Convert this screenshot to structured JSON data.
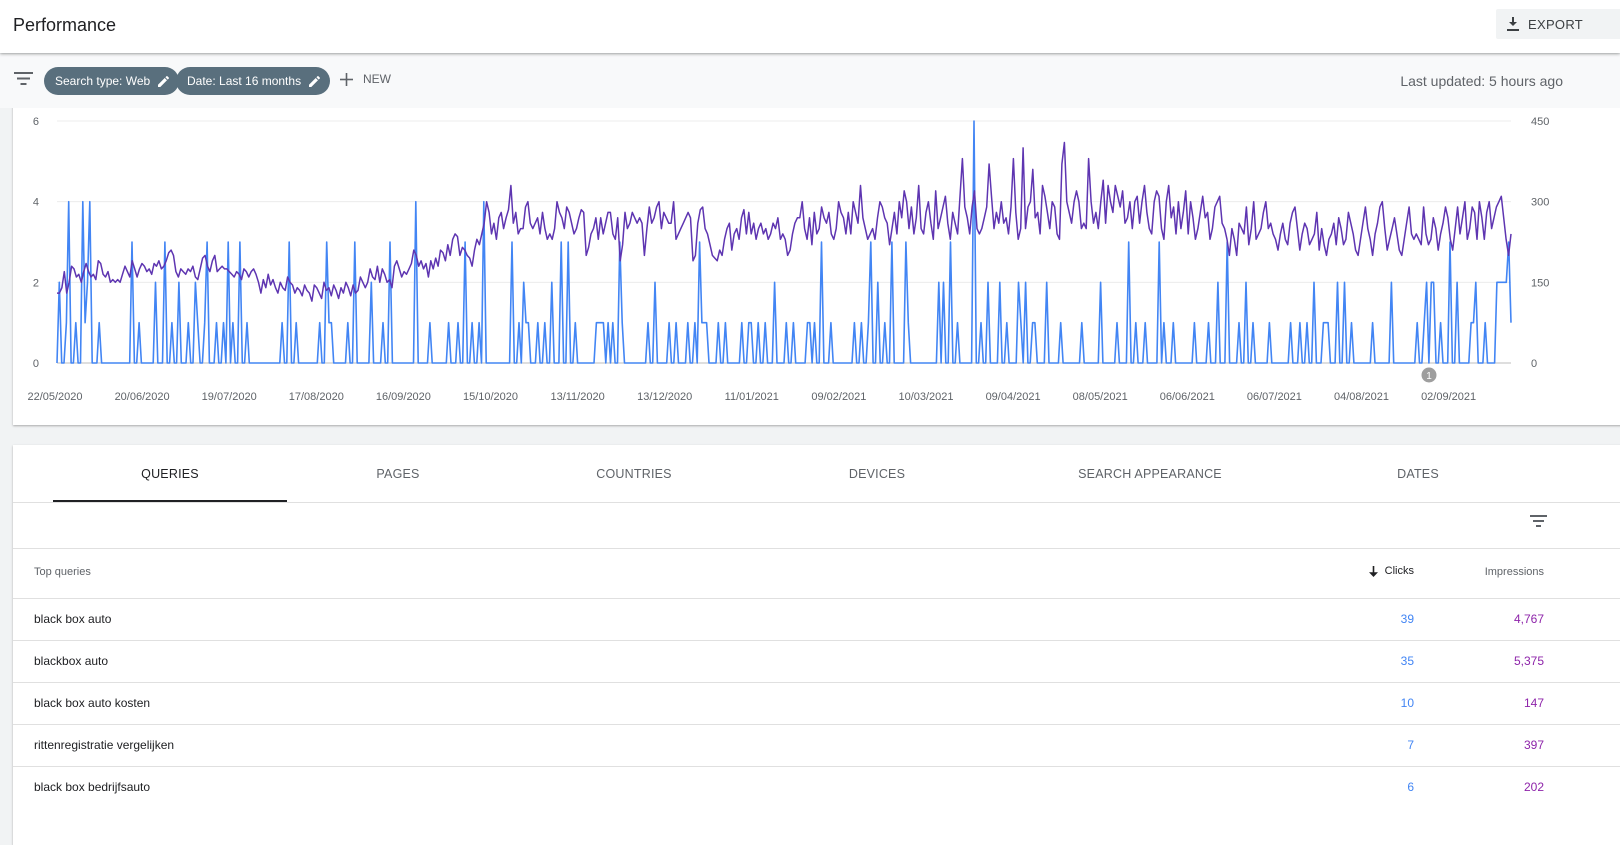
{
  "header": {
    "title": "Performance",
    "export_label": "EXPORT"
  },
  "filters": {
    "chips": [
      "Search type: Web",
      "Date: Last 16 months"
    ],
    "new_label": "NEW",
    "last_updated": "Last updated: 5 hours ago"
  },
  "chart_data": {
    "type": "line",
    "x_tick_labels": [
      "22/05/2020",
      "20/06/2020",
      "19/07/2020",
      "17/08/2020",
      "16/09/2020",
      "15/10/2020",
      "13/11/2020",
      "13/12/2020",
      "11/01/2021",
      "09/02/2021",
      "10/03/2021",
      "09/04/2021",
      "08/05/2021",
      "06/06/2021",
      "06/07/2021",
      "04/08/2021",
      "02/09/2021"
    ],
    "y_left_ticks": [
      "0",
      "2",
      "4",
      "6"
    ],
    "y_right_ticks": [
      "0",
      "150",
      "300",
      "450"
    ],
    "ylim_left": [
      0,
      6
    ],
    "ylim_right": [
      0,
      450
    ],
    "annotation": "1",
    "series": [
      {
        "color": "#4285f4",
        "axis": "left",
        "values": [
          0,
          2,
          0,
          0,
          1,
          4,
          0,
          0,
          1,
          0,
          0,
          4,
          1,
          2,
          4,
          0,
          0,
          0,
          1,
          0,
          0,
          0,
          0,
          0,
          0,
          0,
          0,
          0,
          0,
          0,
          0,
          0,
          3,
          0,
          0,
          1,
          0,
          0,
          0,
          0,
          0,
          0,
          2,
          0,
          0,
          0,
          3,
          0,
          0,
          1,
          0,
          0,
          2,
          0,
          0,
          0,
          1,
          0,
          0,
          2,
          1,
          0,
          0,
          1,
          3,
          0,
          0,
          0,
          1,
          0,
          0,
          1,
          0,
          3,
          0,
          1,
          0,
          0,
          3,
          0,
          0,
          1,
          0,
          0,
          0,
          0,
          0,
          0,
          0,
          0,
          0,
          0,
          0,
          0,
          0,
          0,
          1,
          0,
          0,
          3,
          0,
          0,
          1,
          0,
          0,
          0,
          0,
          0,
          0,
          0,
          0,
          0,
          1,
          0,
          0,
          3,
          1,
          1,
          0,
          0,
          0,
          0,
          0,
          0,
          1,
          0,
          0,
          3,
          0,
          0,
          0,
          0,
          0,
          0,
          2,
          0,
          0,
          0,
          0,
          1,
          0,
          0,
          3,
          0,
          0,
          0,
          0,
          0,
          0,
          0,
          0,
          0,
          0,
          4,
          0,
          0,
          0,
          0,
          0,
          1,
          0,
          0,
          0,
          0,
          0,
          0,
          0,
          1,
          0,
          0,
          0,
          1,
          0,
          0,
          3,
          0,
          0,
          1,
          0,
          0,
          1,
          0,
          4,
          0,
          0,
          0,
          0,
          0,
          0,
          0,
          0,
          0,
          0,
          0,
          3,
          0,
          0,
          1,
          0,
          2,
          1,
          1,
          0,
          0,
          0,
          1,
          0,
          0,
          1,
          0,
          0,
          2,
          0,
          0,
          0,
          3,
          0,
          0,
          3,
          0,
          0,
          1,
          0,
          0,
          0,
          0,
          0,
          0,
          0,
          0,
          1,
          1,
          1,
          1,
          0,
          1,
          0,
          1,
          0,
          0,
          3,
          1,
          0,
          0,
          0,
          0,
          0,
          0,
          0,
          0,
          0,
          0,
          1,
          0,
          0,
          2,
          0,
          0,
          0,
          0,
          0,
          1,
          0,
          0,
          1,
          0,
          0,
          0,
          0,
          1,
          0,
          0,
          1,
          0,
          3,
          1,
          1,
          1,
          0,
          0,
          0,
          0,
          1,
          0,
          0,
          1,
          0,
          0,
          0,
          0,
          0,
          0,
          1,
          0,
          0,
          1,
          1,
          0,
          0,
          1,
          0,
          0,
          1,
          0,
          0,
          0,
          2,
          0,
          0,
          0,
          0,
          1,
          0,
          0,
          1,
          0,
          0,
          0,
          0,
          0,
          1,
          1,
          0,
          1,
          0,
          0,
          3,
          0,
          0,
          0,
          1,
          0,
          0,
          0,
          0,
          0,
          0,
          0,
          0,
          0,
          1,
          0,
          0,
          1,
          0,
          0,
          1,
          3,
          0,
          0,
          2,
          0,
          0,
          1,
          0,
          0,
          3,
          0,
          0,
          0,
          0,
          0,
          3,
          1,
          0,
          0,
          0,
          0,
          0,
          0,
          0,
          0,
          0,
          0,
          0,
          0,
          2,
          0,
          2,
          0,
          0,
          3,
          0,
          0,
          1,
          0,
          0,
          0,
          0,
          0,
          0,
          6,
          0,
          0,
          1,
          0,
          0,
          2,
          0,
          0,
          0,
          0,
          2,
          0,
          0,
          1,
          0,
          0,
          0,
          0,
          2,
          1,
          0,
          2,
          0,
          0,
          1,
          1,
          0,
          0,
          0,
          0,
          2,
          0,
          0,
          0,
          0,
          0,
          1,
          0,
          0,
          0,
          0,
          0,
          0,
          0,
          0,
          1,
          0,
          0,
          0,
          0,
          0,
          0,
          0,
          2,
          0,
          0,
          0,
          0,
          0,
          0,
          1,
          0,
          0,
          0,
          0,
          3,
          0,
          0,
          1,
          0,
          0,
          0,
          1,
          0,
          0,
          0,
          0,
          0,
          3,
          0,
          1,
          0,
          0,
          0,
          1,
          0,
          0,
          0,
          0,
          0,
          0,
          0,
          0,
          1,
          0,
          0,
          0,
          0,
          0,
          1,
          0,
          0,
          0,
          2,
          0,
          0,
          0,
          3,
          0,
          0,
          0,
          0,
          1,
          0,
          0,
          2,
          0,
          0,
          1,
          0,
          0,
          0,
          0,
          0,
          0,
          1,
          0,
          0,
          0,
          0,
          0,
          0,
          0,
          0,
          1,
          0,
          0,
          0,
          1,
          0,
          0,
          1,
          0,
          0,
          2,
          0,
          0,
          0,
          1,
          1,
          1,
          0,
          0,
          0,
          2,
          0,
          0,
          2,
          0,
          0,
          1,
          0,
          0,
          0,
          0,
          0,
          0,
          0,
          0,
          1,
          0,
          0,
          0,
          0,
          0,
          0,
          0,
          2,
          0,
          0,
          0,
          0,
          0,
          0,
          0,
          0,
          0,
          0,
          1,
          0,
          0,
          1,
          2,
          0,
          2,
          2,
          0,
          0,
          1,
          0,
          0,
          0,
          3,
          0,
          0,
          2,
          0,
          0,
          0,
          0,
          0,
          1,
          1,
          2,
          0,
          0,
          0,
          1,
          0,
          0,
          0,
          0,
          2,
          2,
          2,
          2,
          2,
          3,
          1
        ]
      },
      {
        "color": "#5e35b1",
        "axis": "right",
        "values": [
          130,
          130,
          140,
          170,
          130,
          150,
          180,
          175,
          160,
          165,
          150,
          170,
          185,
          170,
          160,
          165,
          155,
          190,
          185,
          165,
          160,
          170,
          150,
          155,
          150,
          155,
          150,
          165,
          180,
          170,
          160,
          190,
          175,
          160,
          175,
          185,
          180,
          170,
          175,
          165,
          185,
          180,
          190,
          175,
          180,
          190,
          205,
          210,
          200,
          170,
          160,
          175,
          170,
          165,
          175,
          170,
          180,
          160,
          155,
          175,
          195,
          200,
          180,
          170,
          190,
          200,
          170,
          175,
          180,
          175,
          175,
          170,
          165,
          160,
          170,
          165,
          155,
          175,
          170,
          160,
          170,
          175,
          165,
          150,
          130,
          155,
          140,
          165,
          145,
          155,
          140,
          130,
          150,
          140,
          135,
          160,
          150,
          145,
          130,
          140,
          135,
          125,
          145,
          135,
          130,
          115,
          145,
          140,
          130,
          120,
          150,
          135,
          140,
          125,
          145,
          135,
          120,
          140,
          130,
          150,
          140,
          125,
          145,
          130,
          135,
          160,
          150,
          140,
          150,
          175,
          160,
          155,
          180,
          150,
          175,
          165,
          150,
          155,
          140,
          180,
          190,
          175,
          160,
          170,
          165,
          175,
          185,
          210,
          200,
          180,
          190,
          175,
          185,
          160,
          190,
          175,
          195,
          180,
          210,
          205,
          190,
          220,
          200,
          230,
          240,
          235,
          200,
          215,
          210,
          200,
          195,
          180,
          210,
          230,
          220,
          240,
          260,
          300,
          280,
          240,
          260,
          230,
          270,
          280,
          250,
          270,
          285,
          330,
          260,
          280,
          240,
          250,
          250,
          290,
          300,
          260,
          250,
          260,
          270,
          240,
          280,
          250,
          230,
          240,
          230,
          250,
          300,
          280,
          270,
          250,
          290,
          280,
          260,
          240,
          250,
          270,
          285,
          280,
          200,
          215,
          240,
          250,
          270,
          230,
          270,
          240,
          260,
          280,
          280,
          240,
          230,
          270,
          190,
          220,
          280,
          250,
          260,
          280,
          270,
          260,
          270,
          260,
          200,
          250,
          290,
          260,
          270,
          290,
          300,
          250,
          280,
          270,
          260,
          260,
          300,
          230,
          240,
          250,
          260,
          270,
          280,
          270,
          190,
          200,
          260,
          285,
          290,
          250,
          240,
          220,
          200,
          195,
          190,
          210,
          200,
          230,
          250,
          260,
          210,
          240,
          250,
          230,
          270,
          285,
          240,
          280,
          240,
          260,
          230,
          250,
          260,
          240,
          250,
          230,
          240,
          260,
          250,
          270,
          230,
          240,
          230,
          200,
          210,
          240,
          260,
          270,
          270,
          300,
          250,
          230,
          270,
          220,
          280,
          240,
          250,
          290,
          270,
          260,
          280,
          240,
          230,
          250,
          300,
          280,
          270,
          240,
          280,
          240,
          300,
          280,
          260,
          330,
          270,
          250,
          230,
          240,
          250,
          230,
          270,
          300,
          290,
          270,
          260,
          220,
          250,
          280,
          240,
          300,
          270,
          320,
          300,
          250,
          290,
          240,
          270,
          330,
          250,
          240,
          280,
          300,
          260,
          230,
          320,
          250,
          270,
          290,
          310,
          260,
          230,
          280,
          260,
          240,
          310,
          380,
          290,
          270,
          240,
          290,
          320,
          250,
          240,
          250,
          270,
          290,
          370,
          310,
          250,
          280,
          260,
          300,
          260,
          270,
          240,
          290,
          380,
          280,
          230,
          250,
          400,
          250,
          290,
          300,
          360,
          270,
          280,
          240,
          330,
          310,
          280,
          250,
          300,
          290,
          240,
          230,
          370,
          410,
          300,
          280,
          260,
          300,
          320,
          300,
          250,
          260,
          250,
          380,
          300,
          260,
          280,
          250,
          300,
          340,
          260,
          330,
          300,
          280,
          330,
          310,
          290,
          320,
          260,
          270,
          300,
          250,
          300,
          310,
          260,
          300,
          330,
          280,
          250,
          240,
          300,
          320,
          310,
          250,
          230,
          300,
          330,
          270,
          290,
          240,
          300,
          250,
          280,
          320,
          240,
          300,
          270,
          230,
          250,
          280,
          310,
          270,
          280,
          230,
          250,
          290,
          300,
          310,
          260,
          250,
          230,
          200,
          250,
          230,
          200,
          260,
          250,
          240,
          290,
          220,
          250,
          300,
          230,
          240,
          250,
          280,
          300,
          250,
          260,
          240,
          230,
          210,
          240,
          260,
          230,
          220,
          260,
          280,
          290,
          250,
          210,
          240,
          260,
          250,
          220,
          230,
          240,
          280,
          210,
          250,
          220,
          200,
          230,
          240,
          260,
          220,
          270,
          250,
          220,
          230,
          280,
          260,
          240,
          210,
          200,
          230,
          260,
          290,
          250,
          230,
          200,
          240,
          260,
          290,
          300,
          250,
          210,
          230,
          250,
          270,
          240,
          210,
          200,
          230,
          260,
          290,
          240,
          230,
          240,
          230,
          220,
          290,
          240,
          220,
          230,
          270,
          250,
          210,
          240,
          260,
          290,
          270,
          230,
          210,
          250,
          290,
          240,
          270,
          300,
          230,
          250,
          290,
          280,
          230,
          300,
          270,
          230,
          280,
          300,
          250,
          270,
          290,
          300,
          310,
          270,
          230,
          200,
          240
        ]
      }
    ]
  },
  "tabs": [
    {
      "label": "QUERIES",
      "active": true
    },
    {
      "label": "PAGES",
      "active": false
    },
    {
      "label": "COUNTRIES",
      "active": false
    },
    {
      "label": "DEVICES",
      "active": false
    },
    {
      "label": "SEARCH APPEARANCE",
      "active": false
    },
    {
      "label": "DATES",
      "active": false
    }
  ],
  "table": {
    "headers": {
      "query": "Top queries",
      "clicks": "Clicks",
      "impressions": "Impressions"
    },
    "rows": [
      {
        "query": "black box auto",
        "clicks": "39",
        "impressions": "4,767"
      },
      {
        "query": "blackbox auto",
        "clicks": "35",
        "impressions": "5,375"
      },
      {
        "query": "black box auto kosten",
        "clicks": "10",
        "impressions": "147"
      },
      {
        "query": "rittenregistratie vergelijken",
        "clicks": "7",
        "impressions": "397"
      },
      {
        "query": "black box bedrijfsauto",
        "clicks": "6",
        "impressions": "202"
      }
    ]
  },
  "colors": {
    "clicks": "#4285f4",
    "impressions": "#8e24aa",
    "chip": "#596f7d"
  }
}
